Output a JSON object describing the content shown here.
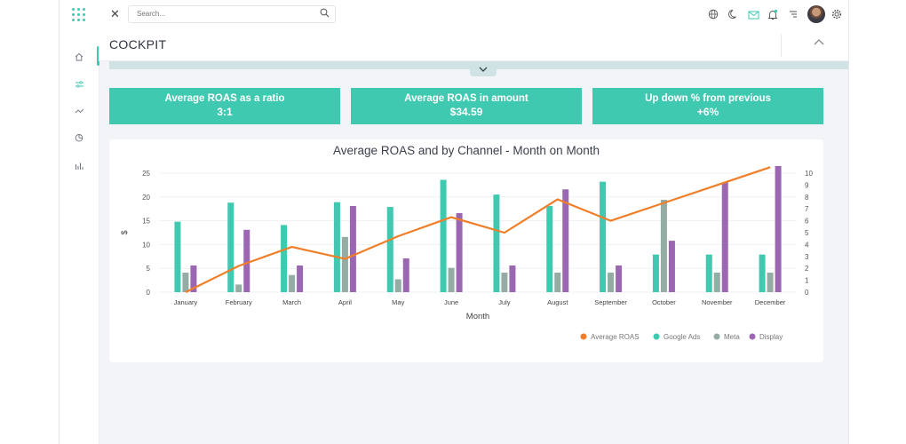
{
  "search": {
    "placeholder": "Search..."
  },
  "page": {
    "title": "COCKPIT"
  },
  "kpis": [
    {
      "label": "Average ROAS as a ratio",
      "value": "3:1"
    },
    {
      "label": "Average ROAS in amount",
      "value": "$34.59"
    },
    {
      "label": "Up down % from previous",
      "value": "+6%"
    }
  ],
  "colors": {
    "accent": "#3ec9b0",
    "roas": "#f07e28",
    "google": "#3ec9b0",
    "meta": "#95aca5",
    "display": "#9b67b3",
    "strip": "#cfe3e4"
  },
  "icons": {
    "sidebar": [
      "home-icon",
      "sliders-icon",
      "trend-icon",
      "pie-chart-icon",
      "bar-chart-icon"
    ],
    "topbar": [
      "globe-icon",
      "moon-icon",
      "mail-icon",
      "bell-icon",
      "menu-icon",
      "gear-icon"
    ]
  },
  "chart_data": {
    "type": "bar",
    "title": "Average ROAS and by Channel - Month on Month",
    "xlabel": "Month",
    "ylabel": "$",
    "ylim": [
      0,
      25
    ],
    "y_ticks": [
      "0",
      "5",
      "10",
      "15",
      "20",
      "25"
    ],
    "y2lim": [
      0,
      10
    ],
    "y2_ticks": [
      "0",
      "1",
      "2",
      "3",
      "4",
      "5",
      "6",
      "7",
      "8",
      "9",
      "10"
    ],
    "categories": [
      "January",
      "February",
      "March",
      "April",
      "May",
      "June",
      "July",
      "August",
      "September",
      "October",
      "November",
      "December"
    ],
    "series": [
      {
        "name": "Google Ads",
        "axis": "left",
        "values": [
          14.8,
          18.8,
          14.1,
          18.9,
          17.9,
          23.6,
          20.5,
          18.1,
          23.2,
          7.9,
          7.9,
          7.9
        ]
      },
      {
        "name": "Meta",
        "axis": "left",
        "values": [
          4.1,
          1.6,
          3.6,
          11.6,
          2.7,
          5.1,
          4.1,
          4.1,
          4.1,
          19.4,
          4.1,
          4.1
        ]
      },
      {
        "name": "Display",
        "axis": "left",
        "values": [
          5.6,
          13.1,
          5.6,
          18.1,
          7.1,
          16.6,
          5.6,
          21.6,
          5.6,
          10.8,
          23.1,
          26.5
        ]
      },
      {
        "name": "Average ROAS",
        "type": "line",
        "axis": "right",
        "values": [
          0,
          2.2,
          3.8,
          2.8,
          4.7,
          6.3,
          5.0,
          7.8,
          6.0,
          7.5,
          9.0,
          10.5
        ]
      }
    ],
    "legend": [
      "Average ROAS",
      "Google Ads",
      "Meta",
      "Display"
    ],
    "legend_position": "bottom-right",
    "grid": true
  }
}
